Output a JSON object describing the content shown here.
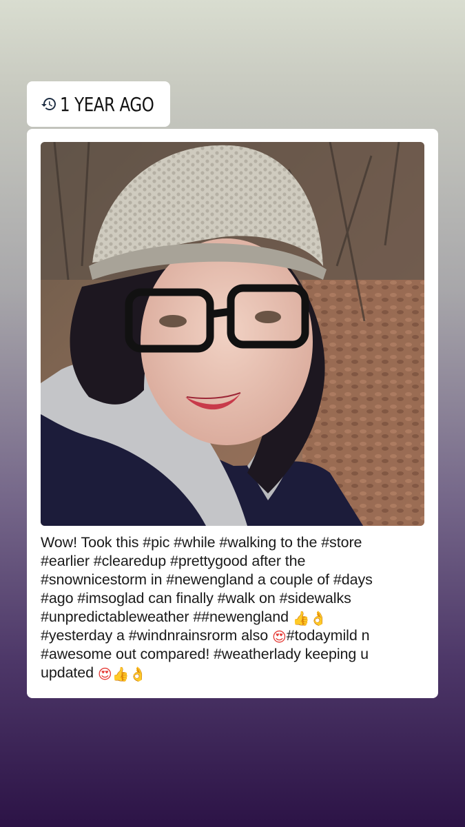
{
  "memory": {
    "label": "1 YEAR AGO",
    "icon": "history-icon"
  },
  "post": {
    "photo_description": "selfie",
    "caption_lines": [
      "Wow! Took this #pic #while #walking to the #store",
      "#earlier #clearedup #prettygood after the",
      "#snownicestorm in #newengland a couple of #days",
      "#ago #imsoglad can finally #walk on #sidewalks",
      "#unpredictableweather ##newengland",
      "#yesterday a #windnrainsrorm also",
      "#todaymild n",
      "#awesome out compared! #weatherlady keeping u",
      "updated"
    ],
    "emojis": {
      "thumbs_up": "👍",
      "ok_hand": "👌",
      "heart_eyes": "😍"
    }
  },
  "colors": {
    "card_background": "#ffffff",
    "text": "#1a1a1a",
    "background_top": "#d9ddd0",
    "background_bottom": "#2c1346"
  }
}
